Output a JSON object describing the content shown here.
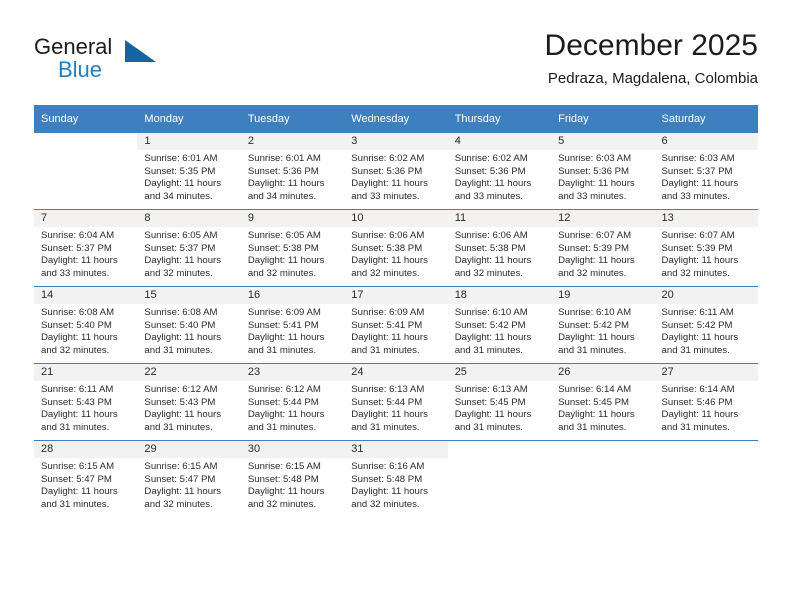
{
  "brand": {
    "name_part1": "General",
    "name_part2": "Blue",
    "triangle_color": "#1464a5",
    "blue_color": "#1f7ec4"
  },
  "header": {
    "title": "December 2025",
    "subtitle": "Pedraza, Magdalena, Colombia"
  },
  "theme": {
    "header_bg": "#3d7fbf",
    "daynum_bg": "#f2f2f2",
    "text_color": "#2b2b2b"
  },
  "weekday_headers": [
    "Sunday",
    "Monday",
    "Tuesday",
    "Wednesday",
    "Thursday",
    "Friday",
    "Saturday"
  ],
  "weeks": [
    [
      {
        "day": "",
        "sunrise": "",
        "sunset": "",
        "daylight_l1": "",
        "daylight_l2": ""
      },
      {
        "day": "1",
        "sunrise": "Sunrise: 6:01 AM",
        "sunset": "Sunset: 5:35 PM",
        "daylight_l1": "Daylight: 11 hours",
        "daylight_l2": "and 34 minutes."
      },
      {
        "day": "2",
        "sunrise": "Sunrise: 6:01 AM",
        "sunset": "Sunset: 5:36 PM",
        "daylight_l1": "Daylight: 11 hours",
        "daylight_l2": "and 34 minutes."
      },
      {
        "day": "3",
        "sunrise": "Sunrise: 6:02 AM",
        "sunset": "Sunset: 5:36 PM",
        "daylight_l1": "Daylight: 11 hours",
        "daylight_l2": "and 33 minutes."
      },
      {
        "day": "4",
        "sunrise": "Sunrise: 6:02 AM",
        "sunset": "Sunset: 5:36 PM",
        "daylight_l1": "Daylight: 11 hours",
        "daylight_l2": "and 33 minutes."
      },
      {
        "day": "5",
        "sunrise": "Sunrise: 6:03 AM",
        "sunset": "Sunset: 5:36 PM",
        "daylight_l1": "Daylight: 11 hours",
        "daylight_l2": "and 33 minutes."
      },
      {
        "day": "6",
        "sunrise": "Sunrise: 6:03 AM",
        "sunset": "Sunset: 5:37 PM",
        "daylight_l1": "Daylight: 11 hours",
        "daylight_l2": "and 33 minutes."
      }
    ],
    [
      {
        "day": "7",
        "sunrise": "Sunrise: 6:04 AM",
        "sunset": "Sunset: 5:37 PM",
        "daylight_l1": "Daylight: 11 hours",
        "daylight_l2": "and 33 minutes."
      },
      {
        "day": "8",
        "sunrise": "Sunrise: 6:05 AM",
        "sunset": "Sunset: 5:37 PM",
        "daylight_l1": "Daylight: 11 hours",
        "daylight_l2": "and 32 minutes."
      },
      {
        "day": "9",
        "sunrise": "Sunrise: 6:05 AM",
        "sunset": "Sunset: 5:38 PM",
        "daylight_l1": "Daylight: 11 hours",
        "daylight_l2": "and 32 minutes."
      },
      {
        "day": "10",
        "sunrise": "Sunrise: 6:06 AM",
        "sunset": "Sunset: 5:38 PM",
        "daylight_l1": "Daylight: 11 hours",
        "daylight_l2": "and 32 minutes."
      },
      {
        "day": "11",
        "sunrise": "Sunrise: 6:06 AM",
        "sunset": "Sunset: 5:38 PM",
        "daylight_l1": "Daylight: 11 hours",
        "daylight_l2": "and 32 minutes."
      },
      {
        "day": "12",
        "sunrise": "Sunrise: 6:07 AM",
        "sunset": "Sunset: 5:39 PM",
        "daylight_l1": "Daylight: 11 hours",
        "daylight_l2": "and 32 minutes."
      },
      {
        "day": "13",
        "sunrise": "Sunrise: 6:07 AM",
        "sunset": "Sunset: 5:39 PM",
        "daylight_l1": "Daylight: 11 hours",
        "daylight_l2": "and 32 minutes."
      }
    ],
    [
      {
        "day": "14",
        "sunrise": "Sunrise: 6:08 AM",
        "sunset": "Sunset: 5:40 PM",
        "daylight_l1": "Daylight: 11 hours",
        "daylight_l2": "and 32 minutes."
      },
      {
        "day": "15",
        "sunrise": "Sunrise: 6:08 AM",
        "sunset": "Sunset: 5:40 PM",
        "daylight_l1": "Daylight: 11 hours",
        "daylight_l2": "and 31 minutes."
      },
      {
        "day": "16",
        "sunrise": "Sunrise: 6:09 AM",
        "sunset": "Sunset: 5:41 PM",
        "daylight_l1": "Daylight: 11 hours",
        "daylight_l2": "and 31 minutes."
      },
      {
        "day": "17",
        "sunrise": "Sunrise: 6:09 AM",
        "sunset": "Sunset: 5:41 PM",
        "daylight_l1": "Daylight: 11 hours",
        "daylight_l2": "and 31 minutes."
      },
      {
        "day": "18",
        "sunrise": "Sunrise: 6:10 AM",
        "sunset": "Sunset: 5:42 PM",
        "daylight_l1": "Daylight: 11 hours",
        "daylight_l2": "and 31 minutes."
      },
      {
        "day": "19",
        "sunrise": "Sunrise: 6:10 AM",
        "sunset": "Sunset: 5:42 PM",
        "daylight_l1": "Daylight: 11 hours",
        "daylight_l2": "and 31 minutes."
      },
      {
        "day": "20",
        "sunrise": "Sunrise: 6:11 AM",
        "sunset": "Sunset: 5:42 PM",
        "daylight_l1": "Daylight: 11 hours",
        "daylight_l2": "and 31 minutes."
      }
    ],
    [
      {
        "day": "21",
        "sunrise": "Sunrise: 6:11 AM",
        "sunset": "Sunset: 5:43 PM",
        "daylight_l1": "Daylight: 11 hours",
        "daylight_l2": "and 31 minutes."
      },
      {
        "day": "22",
        "sunrise": "Sunrise: 6:12 AM",
        "sunset": "Sunset: 5:43 PM",
        "daylight_l1": "Daylight: 11 hours",
        "daylight_l2": "and 31 minutes."
      },
      {
        "day": "23",
        "sunrise": "Sunrise: 6:12 AM",
        "sunset": "Sunset: 5:44 PM",
        "daylight_l1": "Daylight: 11 hours",
        "daylight_l2": "and 31 minutes."
      },
      {
        "day": "24",
        "sunrise": "Sunrise: 6:13 AM",
        "sunset": "Sunset: 5:44 PM",
        "daylight_l1": "Daylight: 11 hours",
        "daylight_l2": "and 31 minutes."
      },
      {
        "day": "25",
        "sunrise": "Sunrise: 6:13 AM",
        "sunset": "Sunset: 5:45 PM",
        "daylight_l1": "Daylight: 11 hours",
        "daylight_l2": "and 31 minutes."
      },
      {
        "day": "26",
        "sunrise": "Sunrise: 6:14 AM",
        "sunset": "Sunset: 5:45 PM",
        "daylight_l1": "Daylight: 11 hours",
        "daylight_l2": "and 31 minutes."
      },
      {
        "day": "27",
        "sunrise": "Sunrise: 6:14 AM",
        "sunset": "Sunset: 5:46 PM",
        "daylight_l1": "Daylight: 11 hours",
        "daylight_l2": "and 31 minutes."
      }
    ],
    [
      {
        "day": "28",
        "sunrise": "Sunrise: 6:15 AM",
        "sunset": "Sunset: 5:47 PM",
        "daylight_l1": "Daylight: 11 hours",
        "daylight_l2": "and 31 minutes."
      },
      {
        "day": "29",
        "sunrise": "Sunrise: 6:15 AM",
        "sunset": "Sunset: 5:47 PM",
        "daylight_l1": "Daylight: 11 hours",
        "daylight_l2": "and 32 minutes."
      },
      {
        "day": "30",
        "sunrise": "Sunrise: 6:15 AM",
        "sunset": "Sunset: 5:48 PM",
        "daylight_l1": "Daylight: 11 hours",
        "daylight_l2": "and 32 minutes."
      },
      {
        "day": "31",
        "sunrise": "Sunrise: 6:16 AM",
        "sunset": "Sunset: 5:48 PM",
        "daylight_l1": "Daylight: 11 hours",
        "daylight_l2": "and 32 minutes."
      },
      {
        "day": "",
        "sunrise": "",
        "sunset": "",
        "daylight_l1": "",
        "daylight_l2": ""
      },
      {
        "day": "",
        "sunrise": "",
        "sunset": "",
        "daylight_l1": "",
        "daylight_l2": ""
      },
      {
        "day": "",
        "sunrise": "",
        "sunset": "",
        "daylight_l1": "",
        "daylight_l2": ""
      }
    ]
  ]
}
